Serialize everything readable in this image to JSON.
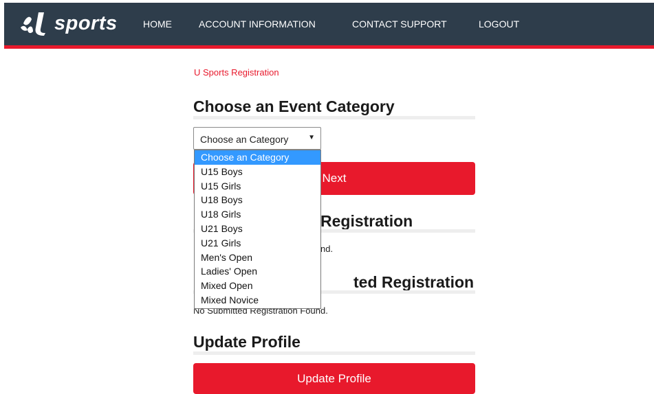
{
  "header": {
    "logo_text": "sports",
    "nav": [
      "HOME",
      "ACCOUNT INFORMATION",
      "CONTACT SUPPORT",
      "LOGOUT"
    ],
    "colors": {
      "bar": "#2e3d4b",
      "accent": "#e8192c"
    }
  },
  "breadcrumb": "U Sports Registration",
  "event_category": {
    "title": "Choose an Event Category",
    "select_value": "Choose an Category",
    "options": [
      "Choose an Category",
      "U15 Boys",
      "U15 Girls",
      "U18 Boys",
      "U18 Girls",
      "U21 Boys",
      "U21 Girls",
      "Men's Open",
      "Ladies' Open",
      "Mixed Open",
      "Mixed Novice"
    ],
    "next_label": "Next"
  },
  "pending": {
    "title": "Registration",
    "note": "nd."
  },
  "submitted": {
    "title": "ted Registration",
    "note": "No Submitted Registration Found."
  },
  "profile": {
    "title": "Update Profile",
    "button_label": "Update Profile"
  }
}
